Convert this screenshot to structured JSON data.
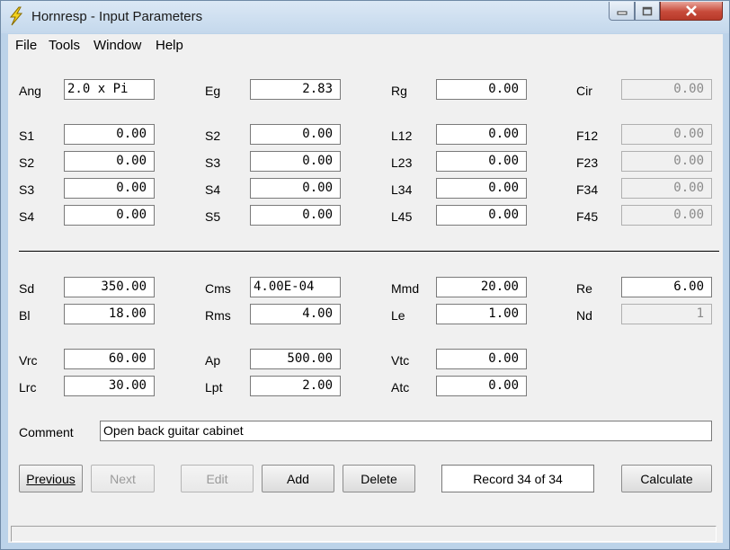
{
  "window": {
    "title": "Hornresp - Input Parameters",
    "app_icon": "lightning-bolt-icon",
    "controls": {
      "minimize": "minimize-icon",
      "maximize": "maximize-icon",
      "close": "close-icon"
    }
  },
  "menu": [
    "File",
    "Tools",
    "Window",
    "Help"
  ],
  "params": {
    "ang": {
      "label": "Ang",
      "value": "2.0 x Pi"
    },
    "eg": {
      "label": "Eg",
      "value": "2.83"
    },
    "rg": {
      "label": "Rg",
      "value": "0.00"
    },
    "cir": {
      "label": "Cir",
      "value": "0.00"
    },
    "r1": [
      {
        "label": "S1",
        "value": "0.00"
      },
      {
        "label": "S2",
        "value": "0.00"
      },
      {
        "label": "L12",
        "value": "0.00"
      },
      {
        "label": "F12",
        "value": "0.00"
      }
    ],
    "r2": [
      {
        "label": "S2",
        "value": "0.00"
      },
      {
        "label": "S3",
        "value": "0.00"
      },
      {
        "label": "L23",
        "value": "0.00"
      },
      {
        "label": "F23",
        "value": "0.00"
      }
    ],
    "r3": [
      {
        "label": "S3",
        "value": "0.00"
      },
      {
        "label": "S4",
        "value": "0.00"
      },
      {
        "label": "L34",
        "value": "0.00"
      },
      {
        "label": "F34",
        "value": "0.00"
      }
    ],
    "r4": [
      {
        "label": "S4",
        "value": "0.00"
      },
      {
        "label": "S5",
        "value": "0.00"
      },
      {
        "label": "L45",
        "value": "0.00"
      },
      {
        "label": "F45",
        "value": "0.00"
      }
    ],
    "driver": [
      [
        {
          "label": "Sd",
          "value": "350.00"
        },
        {
          "label": "Cms",
          "value": "4.00E-04"
        },
        {
          "label": "Mmd",
          "value": "20.00"
        },
        {
          "label": "Re",
          "value": "6.00"
        }
      ],
      [
        {
          "label": "Bl",
          "value": "18.00"
        },
        {
          "label": "Rms",
          "value": "4.00"
        },
        {
          "label": "Le",
          "value": "1.00"
        },
        {
          "label": "Nd",
          "value": "1"
        }
      ]
    ],
    "chambers": [
      [
        {
          "label": "Vrc",
          "value": "60.00"
        },
        {
          "label": "Ap",
          "value": "500.00"
        },
        {
          "label": "Vtc",
          "value": "0.00"
        }
      ],
      [
        {
          "label": "Lrc",
          "value": "30.00"
        },
        {
          "label": "Lpt",
          "value": "2.00"
        },
        {
          "label": "Atc",
          "value": "0.00"
        }
      ]
    ]
  },
  "comment": {
    "label": "Comment",
    "value": "Open back guitar cabinet"
  },
  "buttons": {
    "previous": "Previous",
    "next": "Next",
    "edit": "Edit",
    "add": "Add",
    "delete": "Delete",
    "calculate": "Calculate"
  },
  "record": "Record 34 of 34",
  "status": ""
}
